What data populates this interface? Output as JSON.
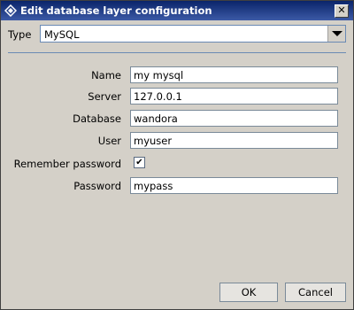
{
  "window": {
    "title": "Edit database layer configuration",
    "close_symbol": "✕"
  },
  "type": {
    "label": "Type",
    "selected": "MySQL"
  },
  "fields": {
    "name": {
      "label": "Name",
      "value": "my mysql"
    },
    "server": {
      "label": "Server",
      "value": "127.0.0.1"
    },
    "database": {
      "label": "Database",
      "value": "wandora"
    },
    "user": {
      "label": "User",
      "value": "myuser"
    },
    "remember": {
      "label": "Remember password",
      "checked": true,
      "mark": "✔"
    },
    "password": {
      "label": "Password",
      "value": "mypass"
    }
  },
  "buttons": {
    "ok": "OK",
    "cancel": "Cancel"
  },
  "colors": {
    "titlebar": "#0a246a",
    "background": "#d4d0c8",
    "field_border": "#7a8a99"
  }
}
